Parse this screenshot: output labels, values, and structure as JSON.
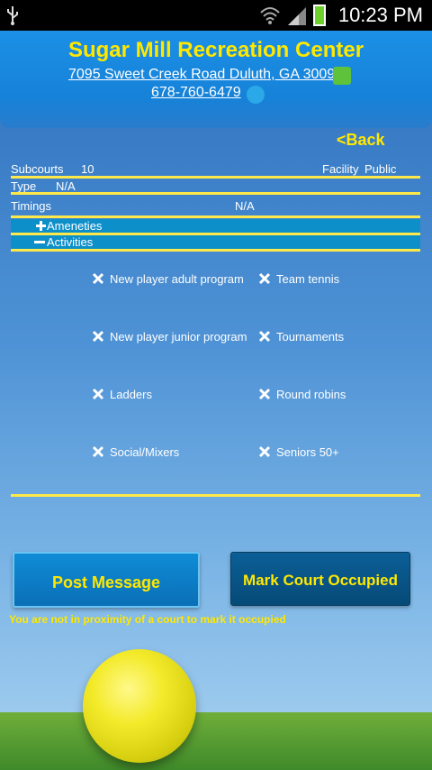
{
  "status_bar": {
    "time": "10:23 PM",
    "icons": [
      "usb-icon",
      "wifi-icon",
      "signal-icon",
      "battery-charging-icon"
    ]
  },
  "header": {
    "title": "Sugar Mill Recreation Center",
    "address": "7095 Sweet Creek Road Duluth, GA 30097",
    "phone": "678-760-6479"
  },
  "nav": {
    "back_label": "<Back"
  },
  "details": {
    "subcourts_label": "Subcourts",
    "subcourts_value": "10",
    "facility_label": "Facility",
    "facility_value": "Public",
    "type_label": "Type",
    "type_value": "N/A",
    "timings_label": "Timings",
    "timings_value": "N/A"
  },
  "sections": {
    "amenities": {
      "label": "Ameneties",
      "expanded": false
    },
    "activities": {
      "label": "Activities",
      "expanded": true
    }
  },
  "activities": [
    "New player adult program",
    "Team tennis",
    "New player junior program",
    "Tournaments",
    "Ladders",
    "Round robins",
    "Social/Mixers",
    "Seniors 50+"
  ],
  "actions": {
    "post_message": "Post Message",
    "mark_occupied": "Mark Court Occupied",
    "proximity_warning": "You are not in proximity of a court to mark it occupied"
  },
  "colors": {
    "accent_yellow": "#ffe800",
    "header_blue": "#1682d8",
    "section_teal": "#0d8fca"
  }
}
